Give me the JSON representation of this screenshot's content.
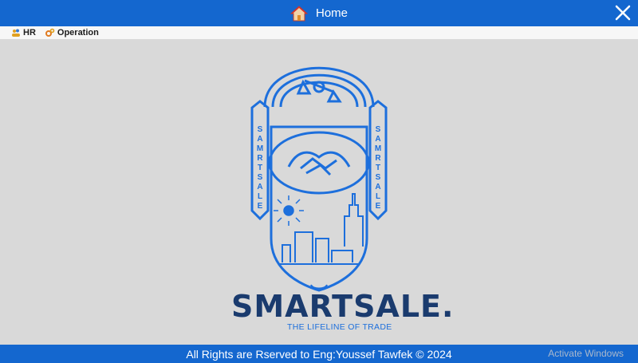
{
  "window": {
    "title": "Home"
  },
  "menu": {
    "items": [
      {
        "label": "HR",
        "icon": "users-icon"
      },
      {
        "label": "Operation",
        "icon": "gears-icon"
      }
    ]
  },
  "emblem": {
    "side_text_left": "SAMRTSALE",
    "side_text_right": "SAMRTSALE"
  },
  "brand": {
    "name": "SMARTSALE.",
    "tagline": "THE LIFELINE OF TRADE"
  },
  "footer": {
    "text": "All Rights are Rserved to Eng:Youssef Tawfek © 2024"
  },
  "watermark": "Activate Windows",
  "colors": {
    "accent": "#1467cf",
    "brand_dark": "#1a3b6e",
    "logo_blue": "#1d6fdc",
    "background": "#d9d9d9"
  }
}
